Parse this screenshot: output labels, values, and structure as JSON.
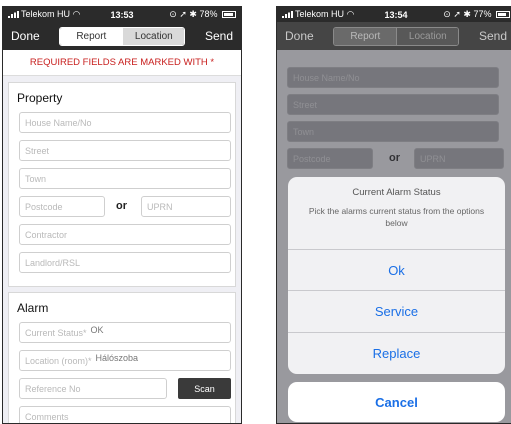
{
  "caption_fragment": "",
  "left_screen": {
    "status": {
      "carrier": "Telekom HU",
      "time": "13:53",
      "battery": "78%"
    },
    "nav": {
      "done": "Done",
      "tab_report": "Report",
      "tab_location": "Location",
      "send": "Send"
    },
    "required_notice": "REQUIRED FIELDS ARE MARKED WITH *",
    "property": {
      "title": "Property",
      "house_placeholder": "House Name/No",
      "street_placeholder": "Street",
      "town_placeholder": "Town",
      "postcode_placeholder": "Postcode",
      "or_label": "or",
      "uprn_placeholder": "UPRN",
      "contractor_placeholder": "Contractor",
      "landlord_placeholder": "Landlord/RSL"
    },
    "alarm": {
      "title": "Alarm",
      "current_status_label": "Current Status*",
      "current_status_value": "OK",
      "location_label": "Location (room)*",
      "location_value": "Hálószoba",
      "reference_placeholder": "Reference No",
      "scan_label": "Scan",
      "comments_placeholder": "Comments"
    }
  },
  "right_screen": {
    "status": {
      "carrier": "Telekom HU",
      "time": "13:54",
      "battery": "77%"
    },
    "nav": {
      "done": "Done",
      "tab_report": "Report",
      "tab_location": "Location",
      "send": "Send"
    },
    "bg_fields": {
      "house": "House Name/No",
      "street": "Street",
      "town": "Town",
      "postcode": "Postcode",
      "or_label": "or",
      "uprn": "UPRN"
    },
    "sheet": {
      "title": "Current Alarm Status",
      "message": "Pick the alarms current status from the options below",
      "options": [
        "Ok",
        "Service",
        "Replace"
      ],
      "cancel": "Cancel"
    }
  }
}
